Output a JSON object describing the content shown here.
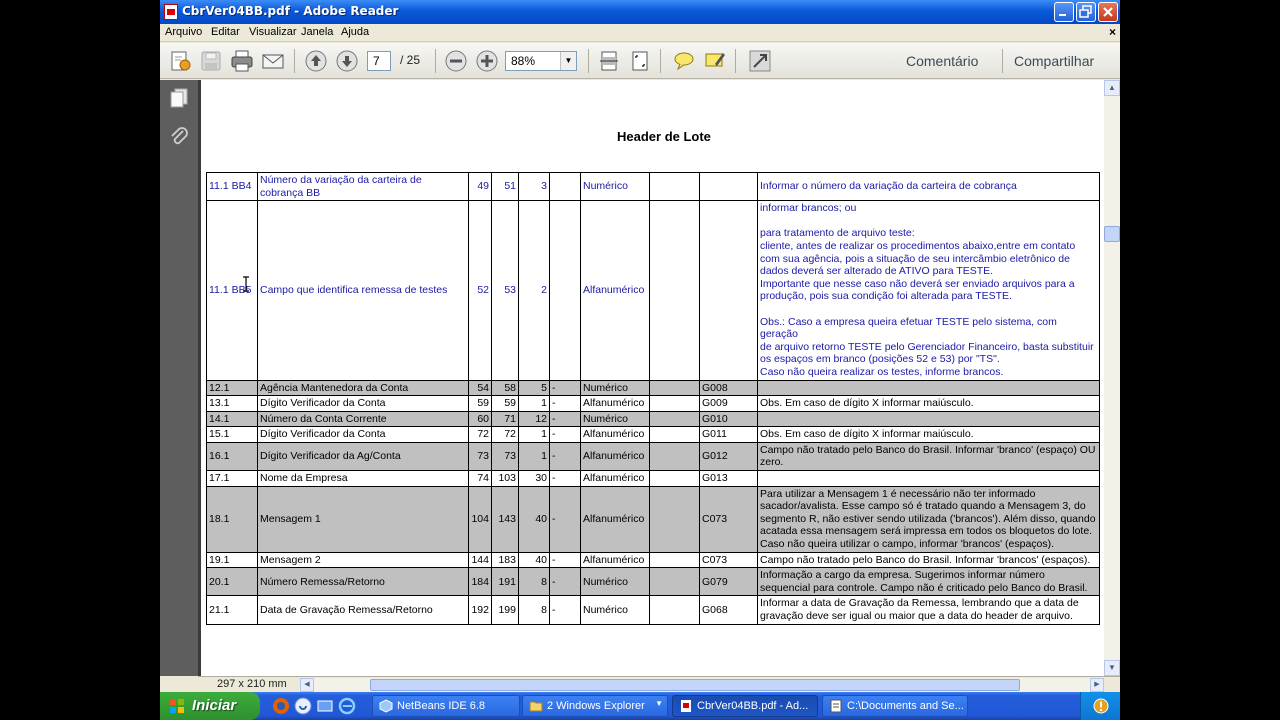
{
  "window": {
    "title": "CbrVer04BB.pdf - Adobe Reader"
  },
  "menu": {
    "items": [
      "Arquivo",
      "Editar",
      "Visualizar",
      "Janela",
      "Ajuda"
    ]
  },
  "toolbar": {
    "current_page": "7",
    "page_total": "/  25",
    "zoom": "88%",
    "comment_label": "Comentário",
    "share_label": "Compartilhar"
  },
  "document": {
    "heading": "Header de Lote",
    "page_size": "297 x 210 mm",
    "rows": [
      {
        "style": "blue",
        "id": "11.1 BB4",
        "desc": "Número da variação da carteira de cobrança BB",
        "start": "49",
        "end": "51",
        "len": "3",
        "dec": "",
        "type": "Numérico",
        "def": "",
        "ref": "",
        "obs": "Informar o número da variação da carteira de cobrança"
      },
      {
        "style": "blue",
        "id": "11.1 BB5",
        "desc": "Campo que identifica remessa de testes",
        "start": "52",
        "end": "53",
        "len": "2",
        "dec": "",
        "type": "Alfanumérico",
        "def": "",
        "ref": "",
        "obs": "informar brancos; ou\n\npara tratamento de arquivo teste:\ncliente,  antes de realizar os procedimentos abaixo,entre em contato com  sua agência,  pois a situação de seu intercâmbio eletrônico de dados deverá ser alterado de ATIVO para TESTE.\nImportante que nesse  caso não  deverá ser  enviado arquivos para a produção, pois sua condição foi alterada para TESTE.\n\nObs.: Caso a empresa queira efetuar TESTE pelo sistema, com geração\nde  arquivo   retorno  TESTE  pelo  Gerenciador  Financeiro,  basta substituir os espaços em branco (posições 52 e 53) por \"TS\".\nCaso não queira realizar os testes, informe brancos."
      },
      {
        "style": "gray",
        "id": "12.1",
        "desc": "Agência Mantenedora da Conta",
        "start": "54",
        "end": "58",
        "len": "5",
        "dec": "-",
        "type": "Numérico",
        "def": "",
        "ref": "G008",
        "obs": ""
      },
      {
        "style": "white",
        "id": "13.1",
        "desc": "Dígito Verificador da Conta",
        "start": "59",
        "end": "59",
        "len": "1",
        "dec": "-",
        "type": "Alfanumérico",
        "def": "",
        "ref": "G009",
        "obs": "Obs. Em caso de dígito X informar maiúsculo."
      },
      {
        "style": "gray",
        "id": "14.1",
        "desc": "Número da Conta Corrente",
        "start": "60",
        "end": "71",
        "len": "12",
        "dec": "-",
        "type": "Numérico",
        "def": "",
        "ref": "G010",
        "obs": ""
      },
      {
        "style": "white",
        "id": "15.1",
        "desc": "Dígito Verificador da Conta",
        "start": "72",
        "end": "72",
        "len": "1",
        "dec": "-",
        "type": "Alfanumérico",
        "def": "",
        "ref": "G011",
        "obs": "Obs. Em caso de dígito X informar maiúsculo."
      },
      {
        "style": "gray",
        "id": "16.1",
        "desc": "Dígito Verificador da Ag/Conta",
        "start": "73",
        "end": "73",
        "len": "1",
        "dec": "-",
        "type": "Alfanumérico",
        "def": "",
        "ref": "G012",
        "obs": "Campo não tratado pelo Banco do Brasil. Informar 'branco' (espaço) OU zero."
      },
      {
        "style": "white",
        "id": "17.1",
        "desc": "Nome da Empresa",
        "start": "74",
        "end": "103",
        "len": "30",
        "dec": "-",
        "type": "Alfanumérico",
        "def": "",
        "ref": "G013",
        "obs": ""
      },
      {
        "style": "gray",
        "id": "18.1",
        "desc": "Mensagem 1",
        "start": "104",
        "end": "143",
        "len": "40",
        "dec": "-",
        "type": "Alfanumérico",
        "def": "",
        "ref": "C073",
        "obs": "Para utilizar a Mensagem 1 é necessário não ter informado sacador/avalista. Esse campo só é tratado quando a Mensagem 3, do segmento R, não estiver sendo utilizada ('brancos'). Além disso, quando acatada essa mensagem será impressa em todos os bloquetos do lote. Caso não queira utilizar o campo, informar 'brancos' (espaços)."
      },
      {
        "style": "white",
        "id": "19.1",
        "desc": "Mensagem 2",
        "start": "144",
        "end": "183",
        "len": "40",
        "dec": "-",
        "type": "Alfanumérico",
        "def": "",
        "ref": "C073",
        "obs": "Campo não tratado pelo Banco do Brasil. Informar 'brancos' (espaços)."
      },
      {
        "style": "gray",
        "id": "20.1",
        "desc": "Número Remessa/Retorno",
        "start": "184",
        "end": "191",
        "len": "8",
        "dec": "-",
        "type": "Numérico",
        "def": "",
        "ref": "G079",
        "obs": "Informação a cargo da empresa. Sugerimos informar número sequencial para controle. Campo não é criticado pelo Banco do Brasil."
      },
      {
        "style": "white",
        "id": "21.1",
        "desc": "Data de Gravação Remessa/Retorno",
        "start": "192",
        "end": "199",
        "len": "8",
        "dec": "-",
        "type": "Numérico",
        "def": "",
        "ref": "G068",
        "obs": "Informar a data de Gravação da Remessa, lembrando que a data de gravação deve ser igual ou maior que a data do header de arquivo."
      }
    ]
  },
  "taskbar": {
    "start_label": "Iniciar",
    "tasks": [
      {
        "label": "NetBeans IDE 6.8",
        "icon": "netbeans-icon"
      },
      {
        "label": "2 Windows Explorer",
        "icon": "folder-icon"
      },
      {
        "label": "CbrVer04BB.pdf - Ad...",
        "icon": "pdf-icon"
      },
      {
        "label": "C:\\Documents and Se...",
        "icon": "notepad-icon"
      }
    ]
  }
}
